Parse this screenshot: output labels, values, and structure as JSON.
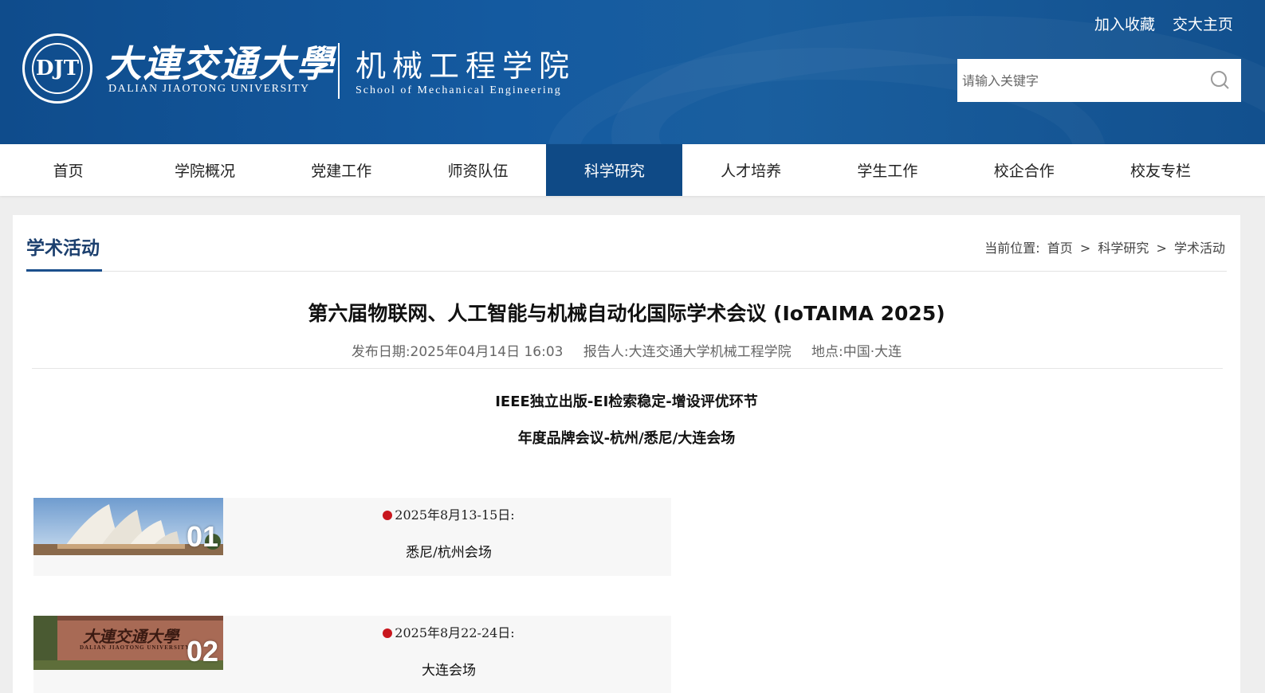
{
  "header": {
    "seal_text": "DJT",
    "university_cn": "大連交通大學",
    "university_en": "DALIAN JIAOTONG UNIVERSITY",
    "school_cn": "机械工程学院",
    "school_en": "School of Mechanical Engineering",
    "links": [
      "加入收藏",
      "交大主页"
    ],
    "search_placeholder": "请输入关键字"
  },
  "nav": {
    "items": [
      "首页",
      "学院概况",
      "党建工作",
      "师资队伍",
      "科学研究",
      "人才培养",
      "学生工作",
      "校企合作",
      "校友专栏"
    ],
    "active_index": 4
  },
  "section": {
    "title": "学术活动",
    "breadcrumb_label": "当前位置:",
    "breadcrumb": [
      "首页",
      "科学研究",
      "学术活动"
    ],
    "separator": ">"
  },
  "article": {
    "title": "第六届物联网、人工智能与机械自动化国际学术会议 (IoTAIMA 2025)",
    "publish_date": "发布日期:2025年04月14日 16:03",
    "reporter": "报告人:大连交通大学机械工程学院",
    "location": "地点:中国·大连",
    "subtitle1": "IEEE独立出版-EI检索稳定-增设评优环节",
    "subtitle2": "年度品牌会议-杭州/悉尼/大连会场"
  },
  "venues": [
    {
      "num": "01",
      "date": "2025年8月13-15日:",
      "city": "悉尼/杭州会场",
      "image": "opera-house-image"
    },
    {
      "num": "02",
      "date": "2025年8月22-24日:",
      "city": "大连会场",
      "image": "university-sign-image",
      "sign_cn": "大連交通大學",
      "sign_en": "DALIAN JIAOTONG UNIVERSITY"
    }
  ],
  "colors": {
    "header_blue": "#145aa0",
    "nav_active": "#0f4a86",
    "accent_red": "#c8161d",
    "title_blue": "#1b3f6e"
  }
}
